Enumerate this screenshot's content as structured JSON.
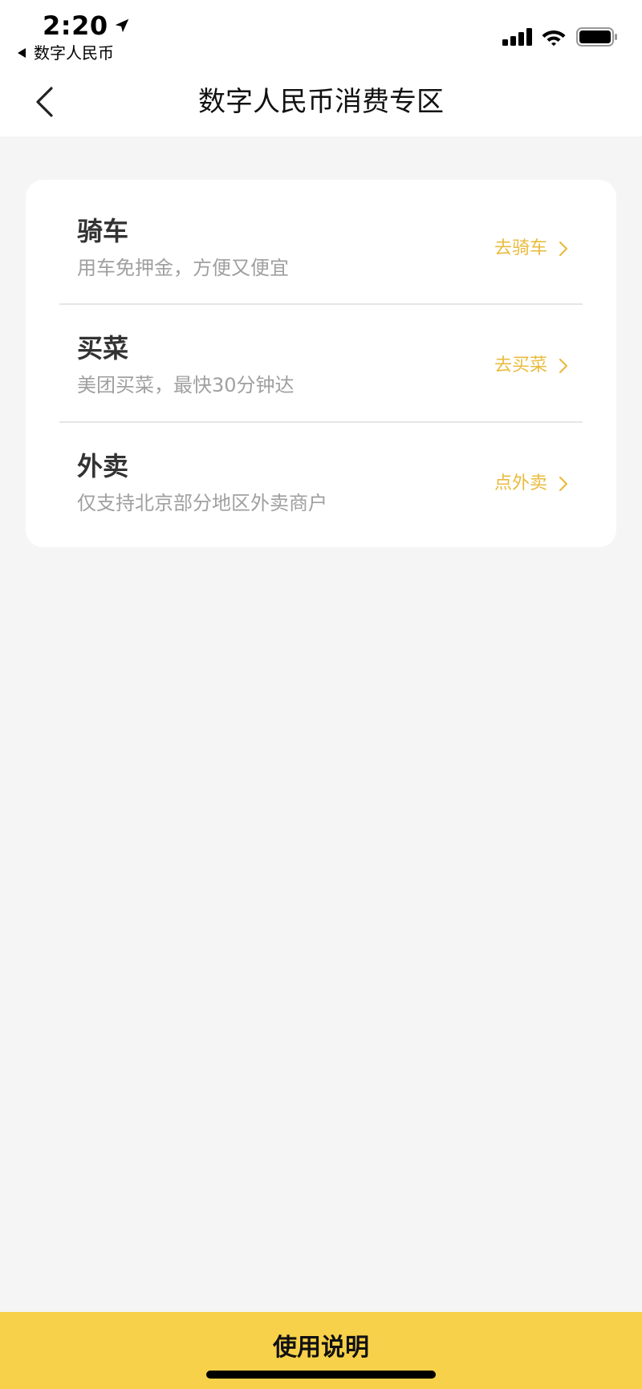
{
  "status_bar": {
    "time": "2:20",
    "back_app": "数字人民币"
  },
  "nav": {
    "title": "数字人民币消费专区"
  },
  "sections": [
    {
      "title": "骑车",
      "subtitle": "用车免押金，方便又便宜",
      "action": "去骑车"
    },
    {
      "title": "买菜",
      "subtitle": "美团买菜，最快30分钟达",
      "action": "去买菜"
    },
    {
      "title": "外卖",
      "subtitle": "仅支持北京部分地区外卖商户",
      "action": "点外卖"
    }
  ],
  "bottom": {
    "label": "使用说明"
  },
  "colors": {
    "accent": "#e9bb3e",
    "bottom_bar": "#f8d14a",
    "background": "#f5f5f5"
  },
  "icons": {
    "status": [
      "location-arrow-icon",
      "back-triangle-icon",
      "cellular-signal-icon",
      "wifi-icon",
      "battery-icon"
    ],
    "nav": "chevron-left-icon",
    "row": "chevron-right-icon"
  }
}
